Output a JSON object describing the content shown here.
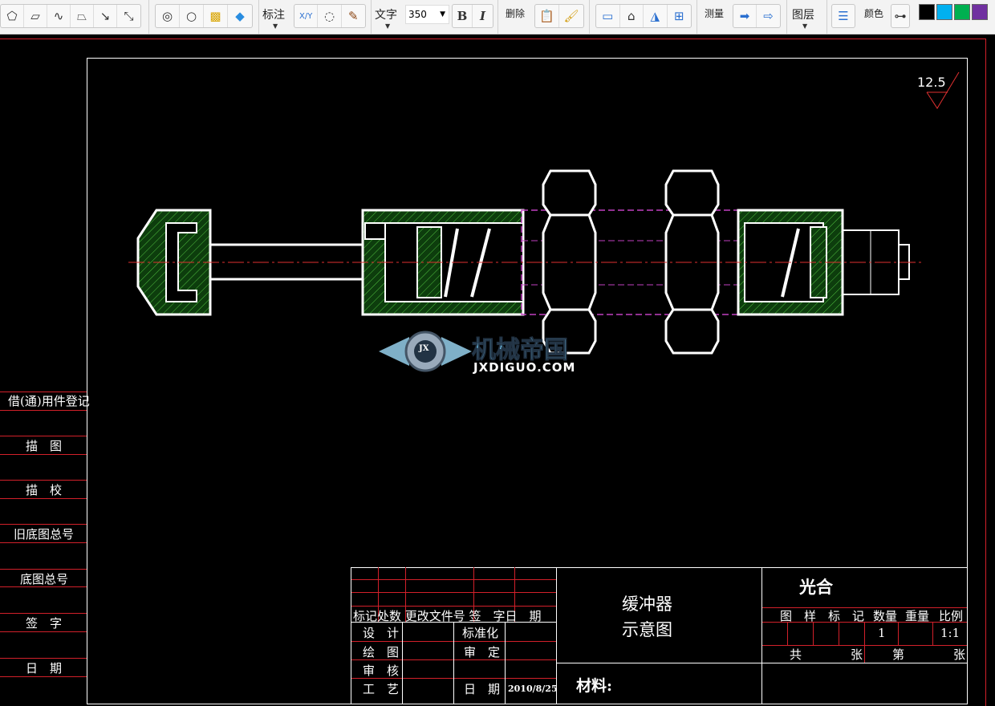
{
  "toolbar": {
    "draw_icons": [
      "pentagon-icon",
      "parallelogram-icon",
      "spline-icon",
      "trapezoid-icon",
      "arrow-line-icon",
      "double-arrow-icon"
    ],
    "edit_icons": [
      "circle-tangent-icon",
      "polygon-circle-icon",
      "hatch-icon",
      "fill-icon"
    ],
    "annotate_label": "标注",
    "text_label": "文字",
    "font_size": "350",
    "bold": "B",
    "italic": "I",
    "delete_label": "删除",
    "measure_label": "测量",
    "layer_label": "图层",
    "color_label": "颜色",
    "colors": [
      "#000000",
      "#00b0f0",
      "#00b050",
      "#7030a0"
    ]
  },
  "drawing": {
    "roughness": "12.5",
    "logo_cn": "机械帝国",
    "logo_en": "JXDIGUO.COM",
    "logo_badge": "JX"
  },
  "side_panel": [
    "借(通)用件登记",
    "描　图",
    "描　校",
    "旧底图总号",
    "底图总号",
    "签　字",
    "日　期"
  ],
  "title_block": {
    "header_row": "标记处数 更改文件号 签　字日　期",
    "design": "设　计",
    "drawing": "绘　图",
    "review": "审　核",
    "process": "工　艺",
    "standard": "标准化",
    "approve": "审　定",
    "date_label": "日　期",
    "date": "2010/8/25",
    "title_line1": "缓冲器",
    "title_line2": "示意图",
    "material": "材料:",
    "company": "光合",
    "cols": [
      "图　样　标　记",
      "数量",
      "重量",
      "比例"
    ],
    "quantity": "1",
    "scale": "1:1",
    "total": "共",
    "sheet_unit1": "张",
    "nth": "第",
    "sheet_unit2": "张"
  }
}
